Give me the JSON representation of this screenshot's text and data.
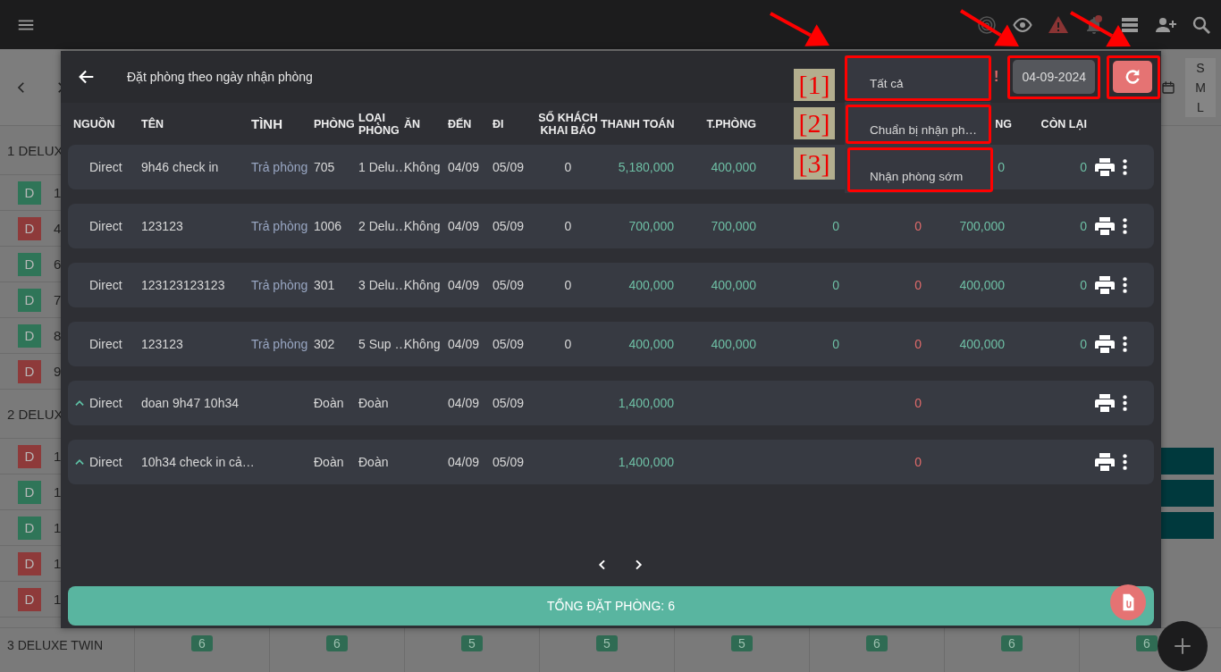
{
  "board": {
    "room_groups": [
      {
        "title": "1 DELUX",
        "rooms": [
          {
            "badge": "D",
            "number": "1",
            "color": "#2f7558"
          },
          {
            "badge": "D",
            "number": "4",
            "color": "#8e3a3a"
          },
          {
            "badge": "D",
            "number": "6",
            "color": "#2f7558"
          },
          {
            "badge": "D",
            "number": "7",
            "color": "#2f7558"
          },
          {
            "badge": "D",
            "number": "8",
            "color": "#2f7558"
          },
          {
            "badge": "D",
            "number": "9",
            "color": "#8e3a3a"
          }
        ]
      },
      {
        "title": "2 DELUX",
        "rooms": [
          {
            "badge": "D",
            "number": "1",
            "color": "#8e3a3a"
          },
          {
            "badge": "D",
            "number": "1",
            "color": "#2f7558"
          },
          {
            "badge": "D",
            "number": "1",
            "color": "#2f7558"
          },
          {
            "badge": "D",
            "number": "1",
            "color": "#8e3a3a"
          },
          {
            "badge": "D",
            "number": "1",
            "color": "#8e3a3a"
          }
        ]
      }
    ],
    "size_column": [
      "S",
      "M",
      "L"
    ],
    "bottom_row": {
      "title": "3 DELUXE TWIN",
      "counts": [
        "6",
        "6",
        "5",
        "5",
        "5",
        "6",
        "6",
        "6"
      ]
    }
  },
  "dialog": {
    "title": "Đặt phòng theo ngày nhận phòng",
    "filter_alert": "!",
    "date": "04-09-2024",
    "status_menu": [
      "Tất cả",
      "Chuẩn bị nhận ph…",
      "Nhận phòng sớm"
    ],
    "columns": [
      {
        "label": "NGUỒN",
        "kind": "text"
      },
      {
        "label": "TÊN",
        "kind": "text"
      },
      {
        "label": "TÌNH",
        "kind": "status"
      },
      {
        "label": "PHÒNG",
        "kind": "text"
      },
      {
        "label": "LOẠI PHÒNG",
        "kind": "text"
      },
      {
        "label": "ĂN",
        "kind": "text"
      },
      {
        "label": "ĐẾN",
        "kind": "text"
      },
      {
        "label": "ĐI",
        "kind": "text"
      },
      {
        "label": "SỐ KHÁCH KHAI BÁO",
        "kind": "count"
      },
      {
        "label": "THANH TOÁN",
        "kind": "money"
      },
      {
        "label": "T.PHÒNG",
        "kind": "money"
      },
      {
        "kind": "money"
      },
      {
        "kind": "deduction"
      },
      {
        "label": "NG",
        "kind": "money"
      },
      {
        "label": "CÒN LẠI",
        "kind": "money"
      }
    ],
    "rows": [
      {
        "kind": "booking",
        "cells": [
          "Direct",
          "9h46 check in",
          "Trả phòng",
          "705",
          "1 Delu…",
          "Không",
          "04/09",
          "05/09",
          "0",
          "5,180,000",
          "400,000",
          null,
          null,
          "0",
          "0"
        ]
      },
      {
        "kind": "booking",
        "cells": [
          "Direct",
          "123123",
          "Trả phòng",
          "1006",
          "2 Delu…",
          "Không",
          "04/09",
          "05/09",
          "0",
          "700,000",
          "700,000",
          "0",
          "0",
          "700,000",
          "0"
        ]
      },
      {
        "kind": "booking",
        "cells": [
          "Direct",
          "123123123123",
          "Trả phòng",
          "301",
          "3 Delu…",
          "Không",
          "04/09",
          "05/09",
          "0",
          "400,000",
          "400,000",
          "0",
          "0",
          "400,000",
          "0"
        ]
      },
      {
        "kind": "booking",
        "cells": [
          "Direct",
          "123123",
          "Trả phòng",
          "302",
          "5 Sup …",
          "Không",
          "04/09",
          "05/09",
          "0",
          "400,000",
          "400,000",
          "0",
          "0",
          "400,000",
          "0"
        ]
      },
      {
        "kind": "group",
        "cells": [
          "Direct",
          "doan 9h47 10h34",
          null,
          "Đoàn",
          "Đoàn",
          null,
          "04/09",
          "05/09",
          null,
          "1,400,000",
          null,
          null,
          "0",
          null,
          null
        ]
      },
      {
        "kind": "group",
        "cells": [
          "Direct",
          "10h34 check in cả…",
          null,
          "Đoàn",
          "Đoàn",
          null,
          "04/09",
          "05/09",
          null,
          "1,400,000",
          null,
          null,
          "0",
          null,
          null
        ]
      }
    ],
    "total": "TỔNG ĐẶT PHÒNG: 6"
  },
  "annotations": [
    {
      "label": "[1]"
    },
    {
      "label": "[2]"
    },
    {
      "label": "[3]"
    }
  ]
}
